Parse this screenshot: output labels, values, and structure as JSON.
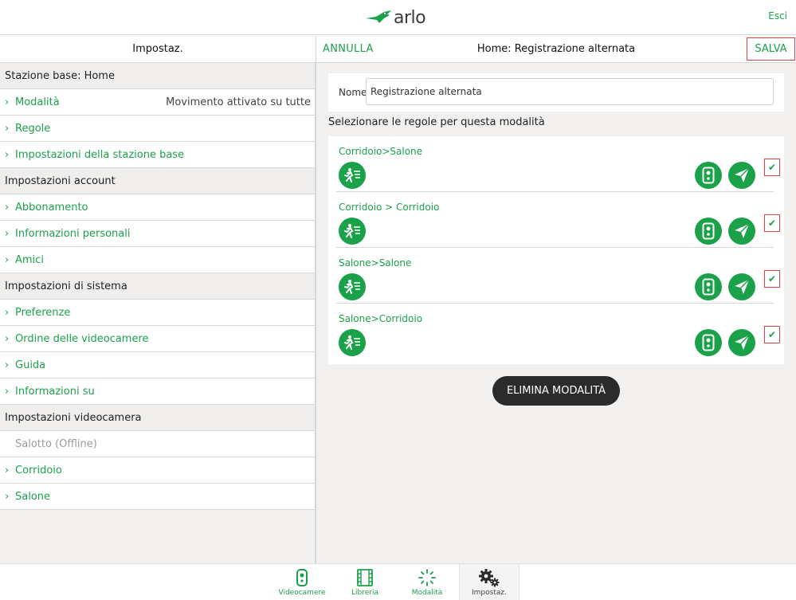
{
  "app": {
    "logo_text": "arlo",
    "exit_label": "Esci"
  },
  "left": {
    "header": "Impostaz.",
    "rows": [
      {
        "type": "section",
        "label": "Stazione base: Home"
      },
      {
        "type": "item",
        "label": "Modalità",
        "value": "Movimento attivato su tutte"
      },
      {
        "type": "item",
        "label": "Regole"
      },
      {
        "type": "item",
        "label": "Impostazioni della stazione base"
      },
      {
        "type": "section",
        "label": "Impostazioni account"
      },
      {
        "type": "item",
        "label": "Abbonamento"
      },
      {
        "type": "item",
        "label": "Informazioni personali"
      },
      {
        "type": "item",
        "label": "Amici"
      },
      {
        "type": "section",
        "label": "Impostazioni di sistema"
      },
      {
        "type": "item",
        "label": "Preferenze"
      },
      {
        "type": "item",
        "label": "Ordine delle videocamere"
      },
      {
        "type": "item",
        "label": "Guida"
      },
      {
        "type": "item",
        "label": "Informazioni su"
      },
      {
        "type": "section",
        "label": "Impostazioni videocamera"
      },
      {
        "type": "disabled",
        "label": "Salotto (Offline)"
      },
      {
        "type": "item",
        "label": "Corridoio"
      },
      {
        "type": "item",
        "label": "Salone"
      }
    ]
  },
  "right": {
    "cancel_label": "ANNULLA",
    "title": "Home: Registrazione alternata",
    "save_label": "SALVA",
    "name_label": "Nome",
    "name_value": "Registrazione alternata",
    "rules_title": "Selezionare le regole per questa modalità",
    "rules": [
      {
        "name": "Corridoio>Salone",
        "checked": true
      },
      {
        "name": "Corridoio > Corridoio",
        "checked": true
      },
      {
        "name": "Salone>Salone",
        "checked": true
      },
      {
        "name": "Salone>Corridoio",
        "checked": true
      }
    ],
    "delete_label": "ELIMINA MODALITÀ"
  },
  "nav": [
    {
      "label": "Videocamere",
      "icon": "camera-icon",
      "active": false
    },
    {
      "label": "Libreria",
      "icon": "film-icon",
      "active": false
    },
    {
      "label": "Modalità",
      "icon": "modes-icon",
      "active": false
    },
    {
      "label": "Impostaz.",
      "icon": "gears-icon",
      "active": true
    }
  ],
  "colors": {
    "accent": "#1aa14a",
    "panel_bg": "#f2f1ef",
    "highlight_border": "#e04040",
    "dark_button": "#2b2b2b"
  }
}
